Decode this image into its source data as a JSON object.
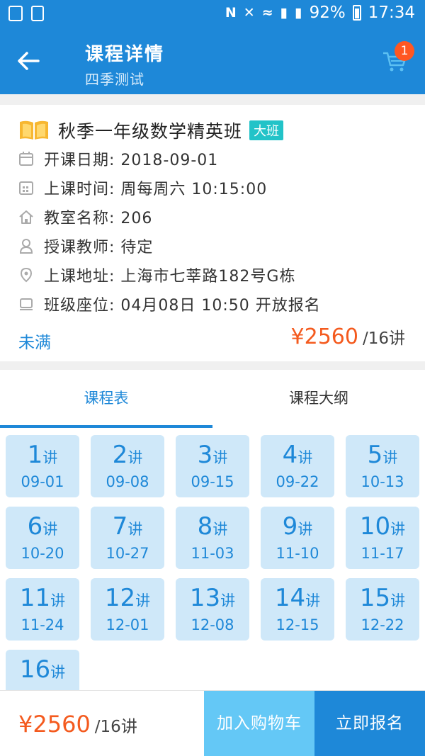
{
  "status_bar": {
    "battery": "92%",
    "time": "17:34"
  },
  "header": {
    "title": "课程详情",
    "subtitle": "四季测试",
    "cart_count": "1"
  },
  "course": {
    "name": "秋季一年级数学精英班",
    "tag": "大班",
    "info": [
      {
        "icon": "calendar-icon",
        "label": "开课日期: 2018-09-01"
      },
      {
        "icon": "schedule-icon",
        "label": "上课时间: 周每周六 10:15:00"
      },
      {
        "icon": "classroom-icon",
        "label": "教室名称: 206"
      },
      {
        "icon": "teacher-icon",
        "label": "授课教师: 待定"
      },
      {
        "icon": "location-icon",
        "label": "上课地址: 上海市七莘路182号G栋"
      },
      {
        "icon": "seat-icon",
        "label": "班级座位: 04月08日 10:50 开放报名"
      }
    ],
    "status": "未满",
    "price": "¥2560",
    "unit": "/16讲"
  },
  "tabs": [
    {
      "label": "课程表",
      "active": true
    },
    {
      "label": "课程大纲",
      "active": false
    }
  ],
  "lesson_suffix": "讲",
  "lessons": [
    {
      "num": "1",
      "date": "09-01"
    },
    {
      "num": "2",
      "date": "09-08"
    },
    {
      "num": "3",
      "date": "09-15"
    },
    {
      "num": "4",
      "date": "09-22"
    },
    {
      "num": "5",
      "date": "10-13"
    },
    {
      "num": "6",
      "date": "10-20"
    },
    {
      "num": "7",
      "date": "10-27"
    },
    {
      "num": "8",
      "date": "11-03"
    },
    {
      "num": "9",
      "date": "11-10"
    },
    {
      "num": "10",
      "date": "11-17"
    },
    {
      "num": "11",
      "date": "11-24"
    },
    {
      "num": "12",
      "date": "12-01"
    },
    {
      "num": "13",
      "date": "12-08"
    },
    {
      "num": "14",
      "date": "12-15"
    },
    {
      "num": "15",
      "date": "12-22"
    },
    {
      "num": "16",
      "date": ""
    }
  ],
  "bottom_bar": {
    "price": "¥2560",
    "unit": "/16讲",
    "add_cart_label": "加入购物车",
    "enroll_label": "立即报名"
  },
  "colors": {
    "primary": "#1e88d8",
    "price": "#f45a1e",
    "tag": "#22c3c8",
    "lesson_bg": "#cfe8f9",
    "cart_button": "#64c8f6",
    "badge": "#ff5722"
  }
}
